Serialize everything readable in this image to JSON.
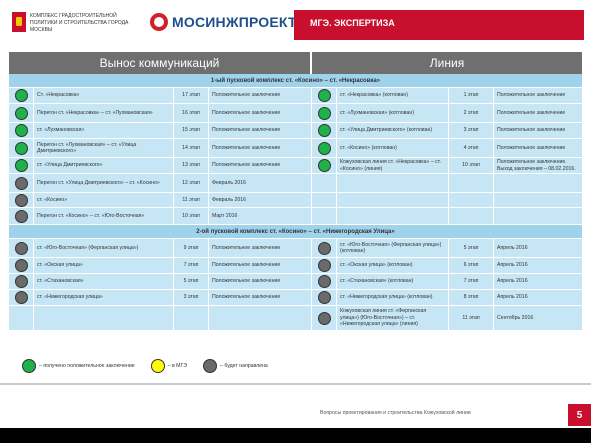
{
  "header": {
    "complex_name": "КОМПЛЕКС ГРАДОСТРОИТЕЛЬНОЙ ПОЛИТИКИ И СТРОИТЕЛЬСТВА ГОРОДА МОСКВЫ",
    "logo_text": "МОСИНЖПРОЕКТ",
    "banner": "МГЭ. ЭКСПЕРТИЗА"
  },
  "table": {
    "col_left": "Вынос коммуникаций",
    "col_right": "Линия",
    "sections": [
      {
        "title": "1-ый пусковой комплекс ст. «Косино» – ст. «Некрасовка»",
        "rows": [
          {
            "l_status": "green",
            "l_name": "Ст. «Некрасовка»",
            "l_floor": "17 этап",
            "l_text": "Положительное заключение",
            "r_status": "green",
            "r_name": "ст. «Некрасовка» (котлован)",
            "r_floor": "1 этап",
            "r_text": "Положительное заключение"
          },
          {
            "l_status": "green",
            "l_name": "Перегон ст. «Некрасовка» – ст. «Лухмановская»",
            "l_floor": "16 этап",
            "l_text": "Положительное заключение",
            "r_status": "green",
            "r_name": "ст. «Лухмановская» (котлован)",
            "r_floor": "2 этап",
            "r_text": "Положительное заключение"
          },
          {
            "l_status": "green",
            "l_name": "ст. «Лухмановская»",
            "l_floor": "15 этап",
            "l_text": "Положительное заключение",
            "r_status": "green",
            "r_name": "ст. «Улица Дмитриевского» (котлован)",
            "r_floor": "3 этап",
            "r_text": "Положительное заключение"
          },
          {
            "l_status": "green",
            "l_name": "Перегон ст. «Лухмановская» – ст. «Улица Дмитриевского»",
            "l_floor": "14 этап",
            "l_text": "Положительное заключение",
            "r_status": "green",
            "r_name": "ст. «Косино» (котлован)",
            "r_floor": "4 этап",
            "r_text": "Положительное заключение"
          },
          {
            "l_status": "green",
            "l_name": "ст. «Улица Дмитриевского»",
            "l_floor": "13 этап",
            "l_text": "Положительное заключение",
            "r_status": "green",
            "r_name": "Кожуховская линия ст. «Некрасовка» – ст. «Косино» (линия)",
            "r_floor": "10 этап",
            "r_text": "Положительное заключение. Выход заключения – 08.02.2016."
          },
          {
            "l_status": "gray",
            "l_name": "Перегон ст. «Улица Дмитриевского» – ст. «Косино»",
            "l_floor": "12 этап",
            "l_text": "Февраль 2016",
            "r_status": "",
            "r_name": "",
            "r_floor": "",
            "r_text": ""
          },
          {
            "l_status": "gray",
            "l_name": "ст. «Косино»",
            "l_floor": "11 этап",
            "l_text": "Февраль 2016",
            "r_status": "",
            "r_name": "",
            "r_floor": "",
            "r_text": ""
          },
          {
            "l_status": "gray",
            "l_name": "Перегон ст. «Косино» – ст. «Юго-Восточная»",
            "l_floor": "10 этап",
            "l_text": "Март 2016",
            "r_status": "",
            "r_name": "",
            "r_floor": "",
            "r_text": ""
          }
        ]
      },
      {
        "title": "2-ой пусковой комплекс ст. «Косино» – ст. «Нижегородская Улица»",
        "rows": [
          {
            "l_status": "gray",
            "l_name": "ст. «Юго-Восточная» (Ферганская улица»)",
            "l_floor": "9 этап",
            "l_text": "Положительное заключение",
            "r_status": "gray",
            "r_name": "ст. «Юго-Восточная» (Ферганская улица») (котлован)",
            "r_floor": "5 этап",
            "r_text": "Апрель 2016"
          },
          {
            "l_status": "gray",
            "l_name": "ст. «Окская улица»",
            "l_floor": "7 этап",
            "l_text": "Положительное заключение",
            "r_status": "gray",
            "r_name": "ст. «Окская улица» (котлован)",
            "r_floor": "6 этап",
            "r_text": "Апрель 2016"
          },
          {
            "l_status": "gray",
            "l_name": "ст. «Стахановская»",
            "l_floor": "5 этап",
            "l_text": "Положительное заключение",
            "r_status": "gray",
            "r_name": "ст. «Стахановская» (котлован)",
            "r_floor": "7 этап",
            "r_text": "Апрель 2016"
          },
          {
            "l_status": "gray",
            "l_name": "ст. «Нижегородская улица»",
            "l_floor": "3 этап",
            "l_text": "Положительное заключение",
            "r_status": "gray",
            "r_name": "ст. «Нижегородская улица» (котлован)",
            "r_floor": "8 этап",
            "r_text": "Апрель 2016"
          },
          {
            "l_status": "",
            "l_name": "",
            "l_floor": "",
            "l_text": "",
            "r_status": "gray",
            "r_name": "Кожуховская линия ст. «Ферганская улица») (Юго-Восточная») – ст. «Нижегородская улица» (линия)",
            "r_floor": "11 этап",
            "r_text": "Сентябрь 2016"
          }
        ]
      }
    ]
  },
  "legend": {
    "green": "– получено положительное заключение",
    "yellow": "– в МГЭ",
    "gray": "– будет направлена"
  },
  "footer": {
    "text": "Вопросы проектирования и строительства Кожуховской линии",
    "page": "5"
  }
}
